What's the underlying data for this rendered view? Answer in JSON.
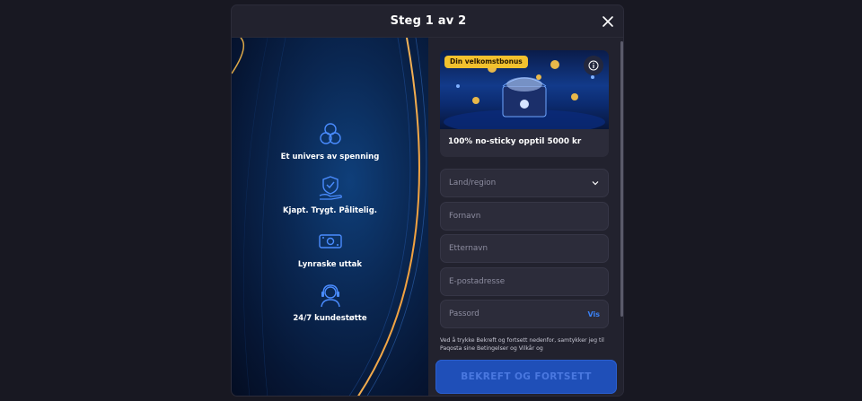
{
  "modal": {
    "title": "Steg 1 av 2",
    "close_icon": "close-icon"
  },
  "features": [
    {
      "icon": "cherries-icon",
      "label": "Et univers av spenning"
    },
    {
      "icon": "shield-hand-icon",
      "label": "Kjapt. Trygt. Pålitelig."
    },
    {
      "icon": "cash-icon",
      "label": "Lynraske uttak"
    },
    {
      "icon": "headset-icon",
      "label": "24/7 kundestøtte"
    }
  ],
  "bonus": {
    "badge": "Din velkomstbonus",
    "text": "100% no-sticky opptil 5000 kr",
    "info_icon": "info-icon"
  },
  "form": {
    "country_placeholder": "Land/region",
    "first_name_placeholder": "Fornavn",
    "last_name_placeholder": "Etternavn",
    "email_placeholder": "E-postadresse",
    "password_placeholder": "Passord",
    "show_password_label": "Vis",
    "terms_text": "Ved å trykke Bekreft og fortsett nedenfor, samtykker jeg til Paqosta sine Betingelser og Vilkår og",
    "submit_label": "BEKREFT OG FORTSETT"
  },
  "colors": {
    "accent": "#1f4fb8",
    "badge": "#f2c12e",
    "link": "#3b82f6",
    "icon_blue": "#4a8cff"
  }
}
